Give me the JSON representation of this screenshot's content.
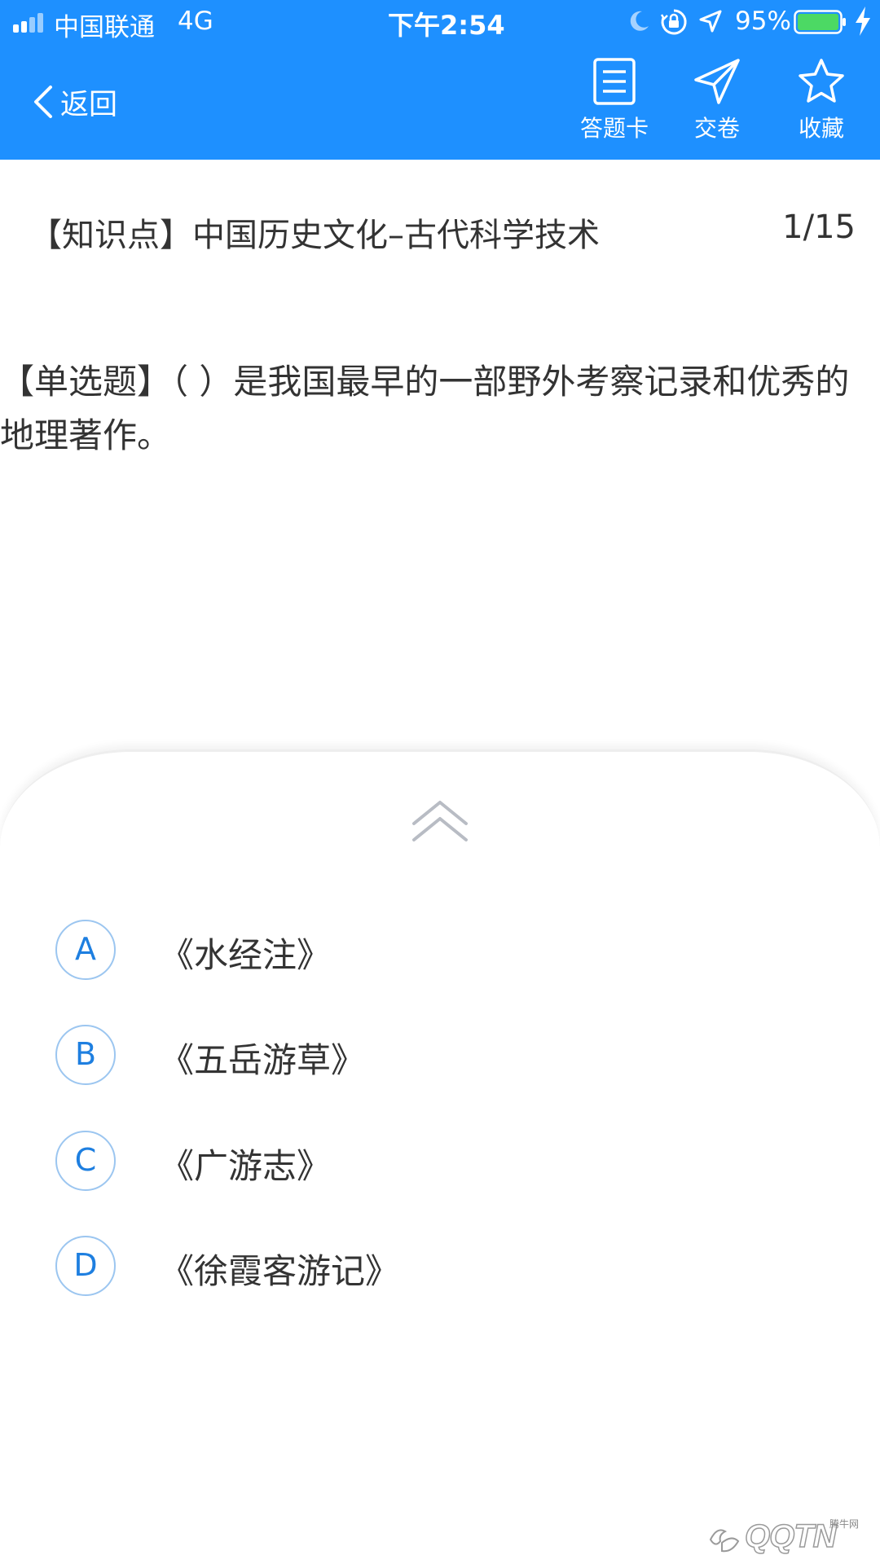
{
  "status_bar": {
    "carrier": "中国联通",
    "network": "4G",
    "time": "下午2:54",
    "battery_percent": "95%",
    "icons": [
      "signal-icon",
      "moon-icon",
      "rotation-lock-icon",
      "location-icon",
      "battery-icon",
      "charging-icon"
    ]
  },
  "nav": {
    "back_label": "返回",
    "answer_card_label": "答题卡",
    "submit_label": "交卷",
    "favorite_label": "收藏"
  },
  "question": {
    "knowledge_point": "【知识点】中国历史文化–古代科学技术",
    "progress": "1/15",
    "stem": "【单选题】（ ）是我国最早的一部野外考察记录和优秀的地理著作。"
  },
  "options": [
    {
      "letter": "A",
      "text": "《水经注》"
    },
    {
      "letter": "B",
      "text": "《五岳游草》"
    },
    {
      "letter": "C",
      "text": "《广游志》"
    },
    {
      "letter": "D",
      "text": "《徐霞客游记》"
    }
  ],
  "watermark": {
    "text": "QQTN",
    "small": "腾牛网"
  },
  "colors": {
    "header_bg": "#1e90ff",
    "option_letter": "#1e7fe0",
    "option_border": "#9cc6f0"
  }
}
